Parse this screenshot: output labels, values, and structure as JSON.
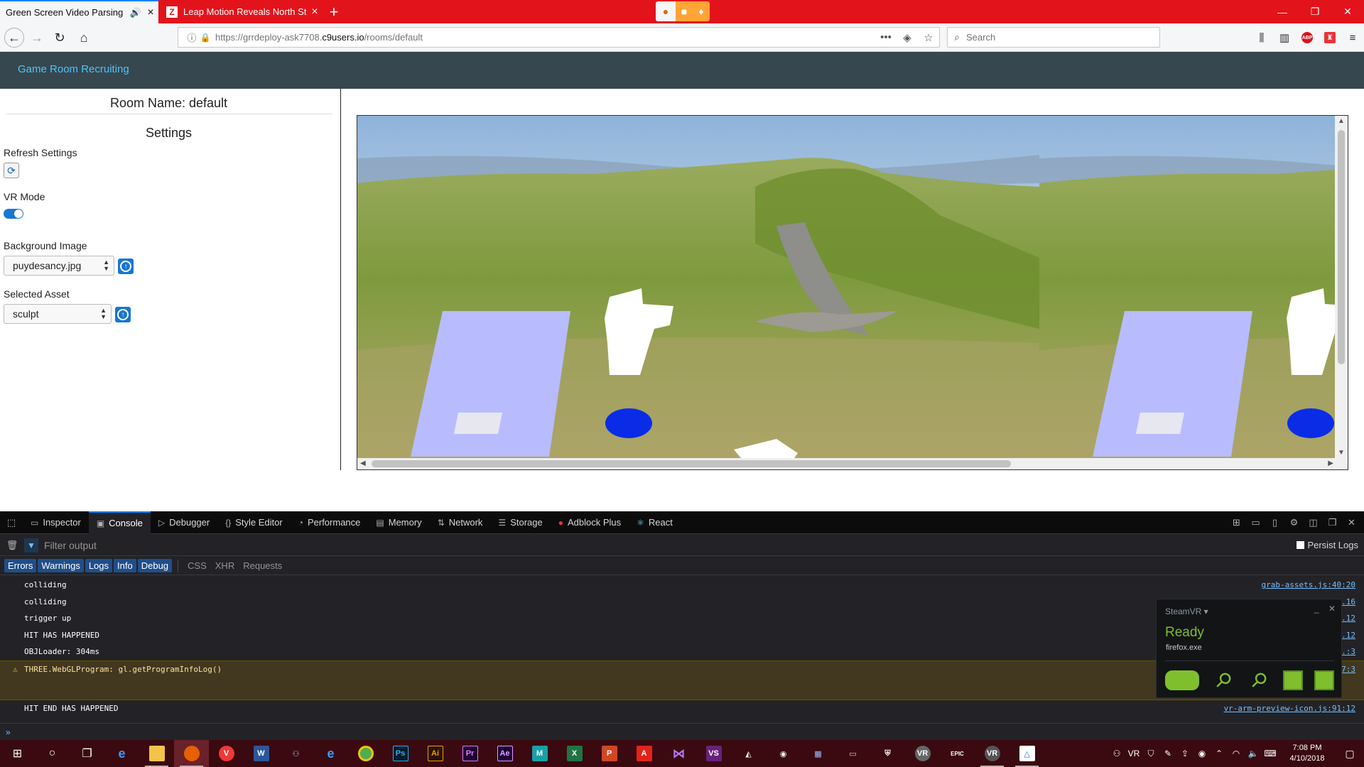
{
  "browser": {
    "tabs": [
      {
        "title": "Green Screen Video Parsing",
        "active": true
      },
      {
        "title": "Leap Motion Reveals North Star",
        "active": false,
        "favicon": "Z"
      }
    ],
    "url_prefix": "https://grrdeploy-ask7708.",
    "url_domain": "c9users.io",
    "url_path": "/rooms/default",
    "search_placeholder": "Search",
    "accent_color": "#e3131b"
  },
  "app": {
    "brand": "Game Room Recruiting",
    "room_name": "Room Name: default",
    "settings_heading": "Settings",
    "refresh_label": "Refresh Settings",
    "vr_mode_label": "VR Mode",
    "vr_mode_on": true,
    "background_label": "Background Image",
    "background_value": "puydesancy.jpg",
    "asset_label": "Selected Asset",
    "asset_value": "sculpt"
  },
  "devtools": {
    "tabs": [
      "Inspector",
      "Console",
      "Debugger",
      "Style Editor",
      "Performance",
      "Memory",
      "Network",
      "Storage",
      "Adblock Plus",
      "React"
    ],
    "selected_tab": "Console",
    "filter_placeholder": "Filter output",
    "persist_label": "Persist Logs",
    "levels": [
      "Errors",
      "Warnings",
      "Logs",
      "Info",
      "Debug"
    ],
    "types": [
      "CSS",
      "XHR",
      "Requests"
    ],
    "logs": [
      {
        "text": "colliding",
        "source": "grab-assets.js:40:20"
      },
      {
        "text": "colliding",
        "source": "...16"
      },
      {
        "text": "trigger up",
        "source": "...12"
      },
      {
        "text": "HIT HAS HAPPENED",
        "source": "...12"
      },
      {
        "text": "OBJLoader: 304ms",
        "source": "...:3"
      },
      {
        "text": "THREE.WebGLProgram: gl.getProgramInfoLog()",
        "source": "...7:3",
        "warning": true
      },
      {
        "text": "HIT END HAS HAPPENED",
        "source": "vr-arm-preview-icon.js:91:12"
      }
    ]
  },
  "steamvr": {
    "title": "SteamVR ▾",
    "status": "Ready",
    "process": "firefox.exe",
    "status_color": "#7fbf2e"
  },
  "taskbar": {
    "time": "7:08 PM",
    "date": "4/10/2018"
  }
}
